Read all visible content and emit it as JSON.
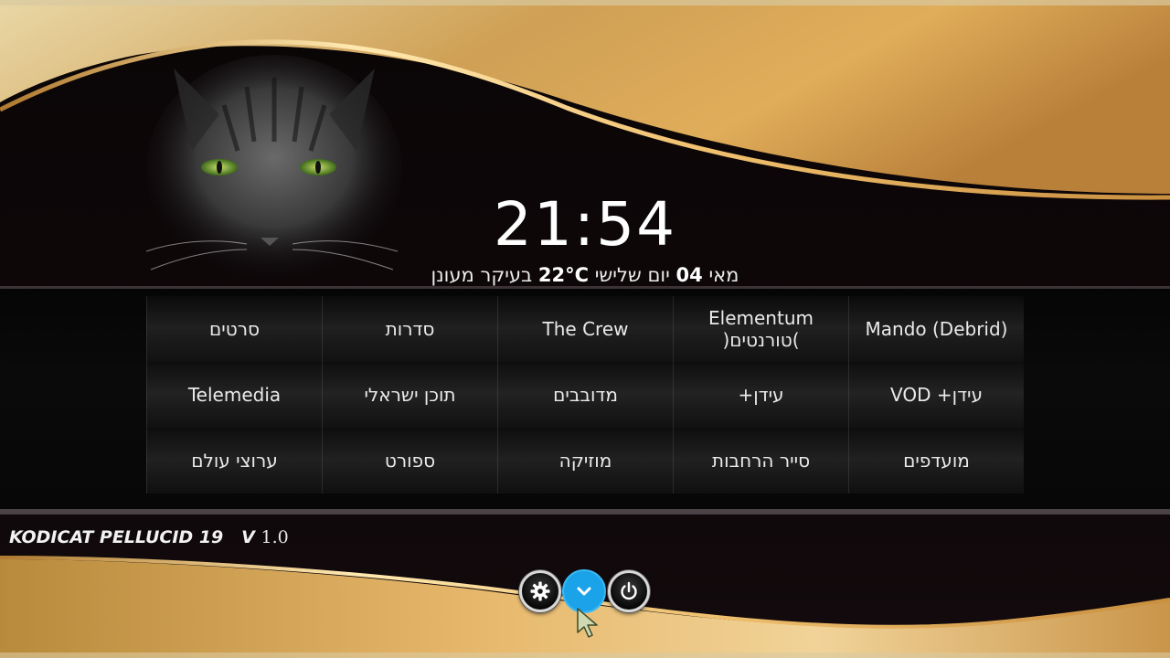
{
  "clock": {
    "time": "21:54"
  },
  "date_weather": {
    "month": "מאי",
    "day_num": "04",
    "weekday": "יום שלישי",
    "temperature": "22°C",
    "condition": "בעיקר מעונן"
  },
  "menu": {
    "rows": [
      [
        {
          "id": "movies",
          "label": "סרטים"
        },
        {
          "id": "series",
          "label": "סדרות"
        },
        {
          "id": "the-crew",
          "label": "The Crew"
        },
        {
          "id": "elementum",
          "label": "Elementum\n(טורנטים)"
        },
        {
          "id": "mando",
          "label": "Mando (Debrid)"
        }
      ],
      [
        {
          "id": "telemedia",
          "label": "Telemedia"
        },
        {
          "id": "israeli-content",
          "label": "תוכן ישראלי"
        },
        {
          "id": "dubbed",
          "label": "מדובבים"
        },
        {
          "id": "eden-plus",
          "label": "עידן+"
        },
        {
          "id": "eden-plus-vod",
          "label": "עידן+ VOD"
        }
      ],
      [
        {
          "id": "world-channels",
          "label": "ערוצי עולם"
        },
        {
          "id": "sport",
          "label": "ספורט"
        },
        {
          "id": "music",
          "label": "מוזיקה"
        },
        {
          "id": "addon-explorer",
          "label": "סייר הרחבות"
        },
        {
          "id": "favourites",
          "label": "מועדפים"
        }
      ]
    ]
  },
  "brand": {
    "name": "KODICAT PELLUCID 19",
    "version_prefix": "V",
    "version": "1.0"
  },
  "bottom_buttons": [
    {
      "id": "settings",
      "icon": "gear-icon"
    },
    {
      "id": "menu-down",
      "icon": "chevron-down-icon"
    },
    {
      "id": "power",
      "icon": "power-icon"
    }
  ],
  "colors": {
    "gold": "#d9a24a",
    "active_button": "#1aa3e8",
    "text": "#ffffff"
  }
}
